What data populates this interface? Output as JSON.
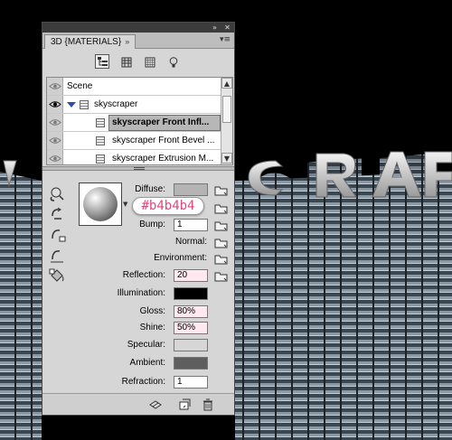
{
  "panel": {
    "title_tab": "3D {MATERIALS}",
    "collapse_icon": "double-chevron-icon",
    "close_icon": "close-icon",
    "menu_icon": "panel-menu-icon"
  },
  "filters": [
    {
      "name": "scene-filter",
      "icon": "tree-icon",
      "active": true
    },
    {
      "name": "mesh-filter",
      "icon": "cylinder-icon",
      "active": false
    },
    {
      "name": "materials-filter",
      "icon": "grid-icon",
      "active": false
    },
    {
      "name": "lights-filter",
      "icon": "bulb-icon",
      "active": false
    }
  ],
  "tree": {
    "rows": [
      {
        "label": "Scene"
      },
      {
        "label": "skyscraper"
      },
      {
        "label": "skyscraper Front Infl..."
      },
      {
        "label": "skyscraper Front Bevel ..."
      },
      {
        "label": "skyscraper Extrusion M..."
      }
    ]
  },
  "props": {
    "diffuse_label": "Diffuse:",
    "diffuse_color": "#b4b4b4",
    "tooltip": "#b4b4b4",
    "bump_label": "Bump:",
    "bump_value": "1",
    "normal_label": "Normal:",
    "environment_label": "Environment:",
    "reflection_label": "Reflection:",
    "reflection_value": "20",
    "illumination_label": "Illumination:",
    "illumination_color": "#000000",
    "gloss_label": "Gloss:",
    "gloss_value": "80%",
    "shine_label": "Shine:",
    "shine_value": "50%",
    "specular_label": "Specular:",
    "specular_color": "#d6d6d6",
    "ambient_label": "Ambient:",
    "ambient_color": "#5e5e5e",
    "refraction_label": "Refraction:",
    "refraction_value": "1"
  },
  "colors": {
    "tooltip_text": "#e4457d",
    "field_bg": "#ffe8ef",
    "panel_bg": "#d6d6d6"
  }
}
